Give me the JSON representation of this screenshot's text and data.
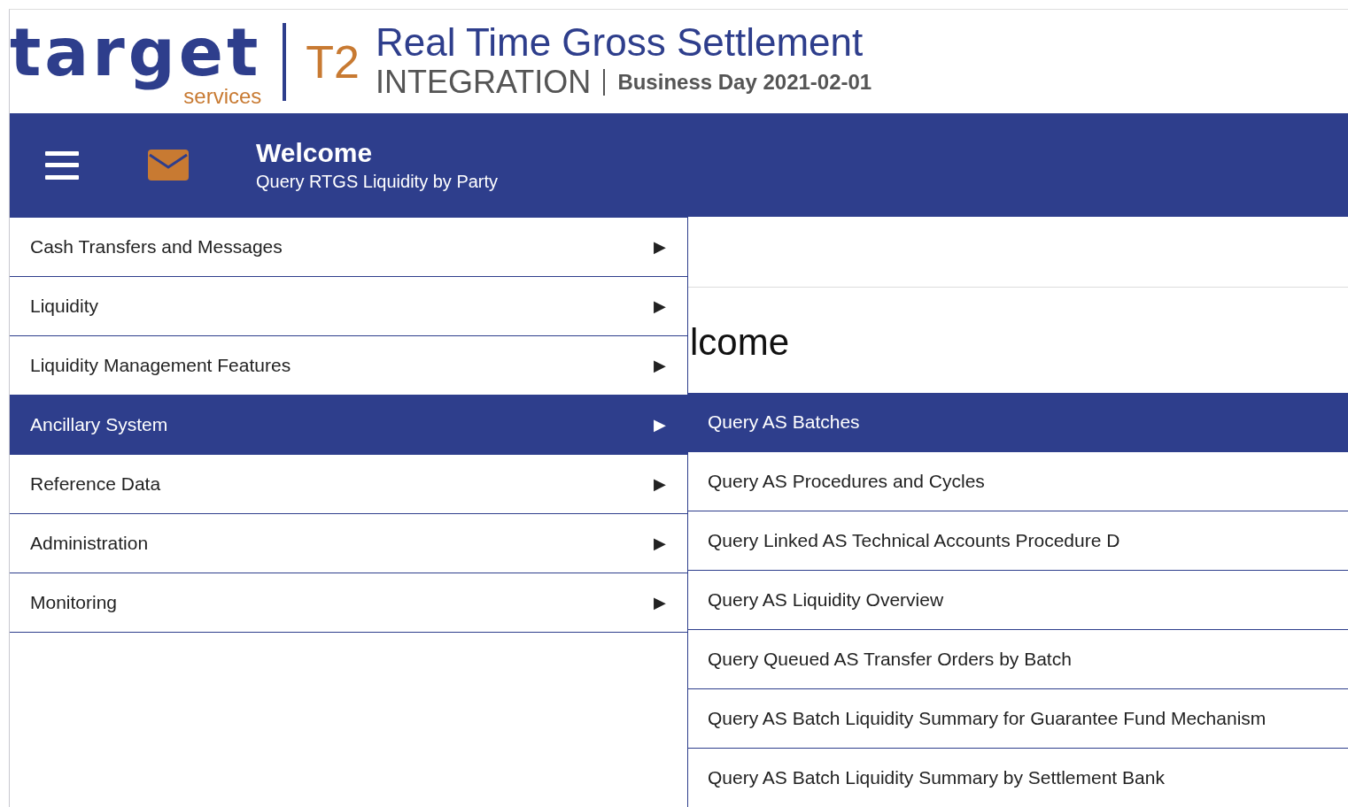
{
  "logo": {
    "wordmark": "target",
    "sub": "services",
    "product": "T2"
  },
  "header": {
    "title": "Real Time Gross Settlement",
    "environment": "INTEGRATION",
    "business_day": "Business Day 2021-02-01"
  },
  "nav_bar": {
    "title": "Welcome",
    "subtitle": "Query RTGS Liquidity by Party"
  },
  "background_heading": "lcome",
  "menu": [
    {
      "label": "Cash Transfers and Messages",
      "arrow": "▶",
      "selected": false
    },
    {
      "label": "Liquidity",
      "arrow": "▶",
      "selected": false
    },
    {
      "label": "Liquidity Management Features",
      "arrow": "▶",
      "selected": false
    },
    {
      "label": "Ancillary System",
      "arrow": "▶",
      "selected": true
    },
    {
      "label": "Reference Data",
      "arrow": "▶",
      "selected": false
    },
    {
      "label": "Administration",
      "arrow": "▶",
      "selected": false
    },
    {
      "label": "Monitoring",
      "arrow": "▶",
      "selected": false
    }
  ],
  "submenu": [
    {
      "label": "Query AS Batches",
      "selected": true
    },
    {
      "label": "Query AS Procedures and Cycles",
      "selected": false
    },
    {
      "label": "Query Linked AS Technical Accounts Procedure D",
      "selected": false
    },
    {
      "label": "Query AS Liquidity Overview",
      "selected": false
    },
    {
      "label": "Query Queued AS Transfer Orders by Batch",
      "selected": false
    },
    {
      "label": "Query AS Batch Liquidity Summary for Guarantee Fund Mechanism",
      "selected": false
    },
    {
      "label": "Query AS Batch Liquidity Summary by Settlement Bank",
      "selected": false
    }
  ]
}
